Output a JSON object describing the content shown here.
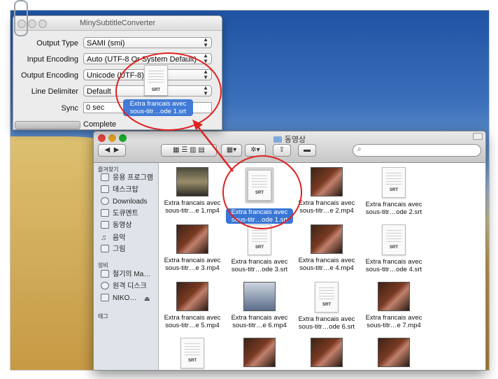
{
  "converter": {
    "title": "MinySubtitleConverter",
    "fields": [
      {
        "label": "Output Type",
        "value": "SAMI (smi)"
      },
      {
        "label": "Input Encoding",
        "value": "Auto (UTF-8 Or System Default)"
      },
      {
        "label": "Output Encoding",
        "value": "Unicode (UTF-8)"
      },
      {
        "label": "Line Delimiter",
        "value": "Default"
      }
    ],
    "sync_label": "Sync",
    "sync_value": "0 sec",
    "status": "Complete"
  },
  "drag": {
    "file_label": "Extra francais avec sous-titr…ode 1.srt",
    "icon_text": "SRT"
  },
  "finder": {
    "title": "동영상",
    "sidebar": {
      "favorites_header": "즐겨찾기",
      "favorites": [
        "응용 프로그램",
        "데스크탑",
        "Downloads",
        "도큐멘트",
        "동영상",
        "음악",
        "그림"
      ],
      "devices_header": "장비",
      "devices": [
        "철기의 Ma…",
        "원격 디스크",
        "NIKO…"
      ],
      "tags_header": "태그"
    },
    "items": [
      {
        "kind": "video",
        "line1": "Extra francais avec",
        "line2": "sous-titr…e 1.mp4"
      },
      {
        "kind": "srt",
        "line1": "Extra francais avec",
        "line2": "sous-titr…ode 1.srt",
        "selected": true
      },
      {
        "kind": "video",
        "line1": "Extra francais avec",
        "line2": "sous-titr…e 2.mp4"
      },
      {
        "kind": "srt",
        "line1": "Extra francais avec",
        "line2": "sous-titr…ode 2.srt"
      },
      {
        "kind": "video",
        "line1": "Extra francais avec",
        "line2": "sous-titr…e 3.mp4"
      },
      {
        "kind": "srt",
        "line1": "Extra francais avec",
        "line2": "sous-titr…ode 3.srt"
      },
      {
        "kind": "video",
        "line1": "Extra francais avec",
        "line2": "sous-titr…e 4.mp4"
      },
      {
        "kind": "srt",
        "line1": "Extra francais avec",
        "line2": "sous-titr…ode 4.srt"
      },
      {
        "kind": "video",
        "line1": "Extra francais avec",
        "line2": "sous-titr…e 5.mp4"
      },
      {
        "kind": "video",
        "line1": "Extra francais avec",
        "line2": "sous-titr…e 6.mp4"
      },
      {
        "kind": "srt",
        "line1": "Extra francais avec",
        "line2": "sous-titr…ode 6.srt"
      },
      {
        "kind": "video",
        "line1": "Extra francais avec",
        "line2": "sous-titr…e 7.mp4"
      },
      {
        "kind": "srt",
        "line1": "",
        "line2": ""
      },
      {
        "kind": "video",
        "line1": "",
        "line2": ""
      },
      {
        "kind": "video",
        "line1": "",
        "line2": ""
      },
      {
        "kind": "video",
        "line1": "",
        "line2": ""
      }
    ],
    "icon_text": "SRT"
  },
  "colors": {
    "selection": "#3876d6",
    "annotation": "#e02121"
  }
}
